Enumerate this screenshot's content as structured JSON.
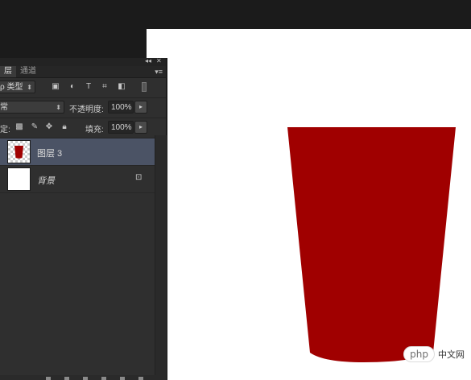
{
  "panel": {
    "tabs": [
      {
        "label": "层",
        "active": true
      },
      {
        "label": "通道",
        "active": false
      }
    ],
    "collapse_glyph": "◂◂",
    "close_glyph": "✕",
    "menu_glyph": "▾≡",
    "filter": {
      "label": "ρ 类型",
      "arrow": "⬍"
    },
    "filter_icons": [
      "image-filter-icon",
      "adjustment-filter-icon",
      "type-filter-icon",
      "shape-filter-icon",
      "smart-object-filter-icon"
    ],
    "blend_mode": {
      "value": "常",
      "arrow": "⬍"
    },
    "opacity": {
      "label": "不透明度:",
      "value": "100%",
      "spin": "▸"
    },
    "lock": {
      "label": "定:"
    },
    "fill": {
      "label": "填充:",
      "value": "100%",
      "spin": "▸"
    },
    "layers": [
      {
        "name": "图层 3",
        "selected": true,
        "italic": false
      },
      {
        "name": "背景",
        "selected": false,
        "italic": true,
        "locked": true
      }
    ]
  },
  "watermark": {
    "logo": "php",
    "text": "中文网"
  },
  "colors": {
    "cup": "#a00000",
    "canvas": "#ffffff",
    "selected_row": "#4b5365"
  }
}
